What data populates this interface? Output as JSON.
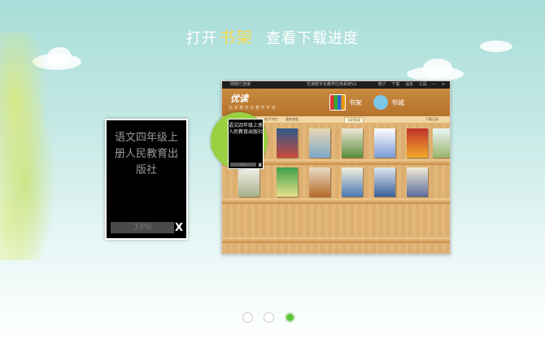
{
  "heading": {
    "prefix": "打开",
    "highlight": "书架",
    "suffix": "查看下载进度"
  },
  "download_card": {
    "book_title": "语文四年级上册人民教育出版社",
    "progress_text": "33%",
    "progress": 0.33,
    "close_label": "X"
  },
  "app": {
    "titlebar_left": "网络已连接",
    "titlebar_center": "优读数字化教学应用系统V2",
    "titlebar_right": [
      "账户",
      "下载",
      "消息",
      "工具",
      "—",
      "×"
    ],
    "logo": "优读",
    "logo_sub": "北 京 数 字 化 教 学 平 台",
    "tab_bookshelf": "书架",
    "tab_bookstore": "书城",
    "subbar_links": [
      "电子书包",
      "我的课堂"
    ],
    "notice": "当前登录",
    "download_record": "下载记录"
  },
  "pager": {
    "count": 3,
    "active_index": 2
  },
  "colors": {
    "highlight": "#f5d957",
    "pager_active": "#5cc43a",
    "bubble": "#9bd043"
  }
}
